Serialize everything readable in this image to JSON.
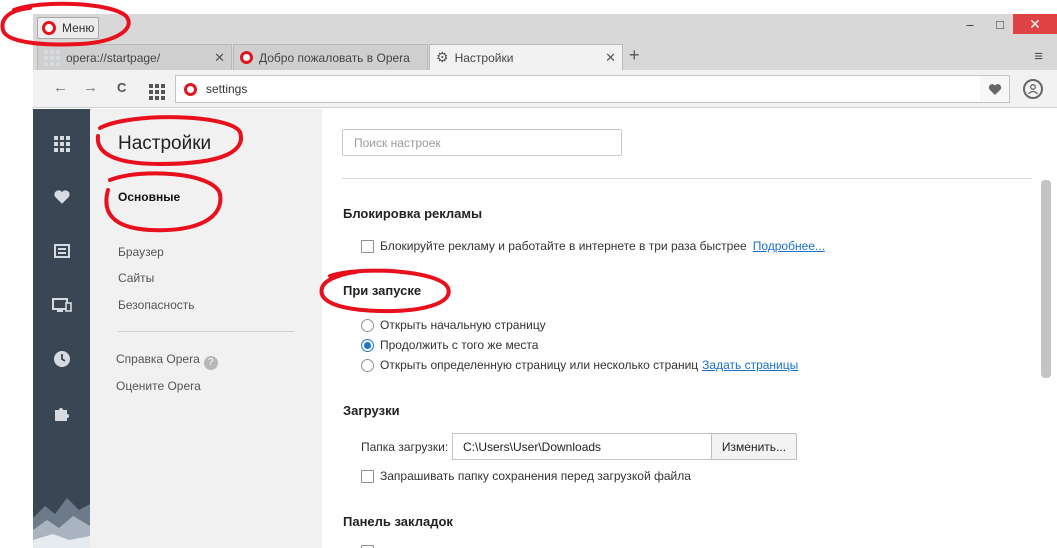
{
  "window": {
    "menu_label": "Меню",
    "controls": {
      "minimize": "–",
      "maximize": "□",
      "close": "✕"
    }
  },
  "tabs": [
    {
      "label": "opera://startpage/",
      "icon": "grid-icon",
      "active": false
    },
    {
      "label": "Добро пожаловать в Opera",
      "icon": "opera-icon",
      "active": false
    },
    {
      "label": "Настройки",
      "icon": "gear-icon",
      "active": true
    }
  ],
  "tabbar": {
    "new_tab": "+",
    "tab_menu": "≡",
    "close_glyph": "✕"
  },
  "address_bar": {
    "back": "←",
    "forward": "→",
    "reload": "C",
    "url": "settings"
  },
  "sidebar_icons": [
    "speed-dial-icon",
    "heart-icon",
    "news-icon",
    "devices-icon",
    "history-icon",
    "extensions-icon"
  ],
  "settings_nav": {
    "title": "Настройки",
    "items": [
      "Основные",
      "Браузер",
      "Сайты",
      "Безопасность"
    ],
    "help": "Справка Opera",
    "help_mark": "?",
    "rate": "Оцените Opera"
  },
  "main": {
    "search_placeholder": "Поиск настроек",
    "adblock": {
      "title": "Блокировка рекламы",
      "checkbox_label": "Блокируйте рекламу и работайте в интернете в три раза быстрее",
      "link": "Подробнее..."
    },
    "startup": {
      "title": "При запуске",
      "options": [
        "Открыть начальную страницу",
        "Продолжить с того же места",
        "Открыть определенную страницу или несколько страниц"
      ],
      "selected": 1,
      "link": "Задать страницы"
    },
    "downloads": {
      "title": "Загрузки",
      "folder_label": "Папка загрузки:",
      "folder_path": "C:\\Users\\User\\Downloads",
      "change_button": "Изменить...",
      "ask_checkbox": "Запрашивать папку сохранения перед загрузкой файла"
    },
    "bookmarks_bar": {
      "title": "Панель закладок"
    }
  },
  "colors": {
    "annotation_red": "#e8101c",
    "accent_blue": "#1e73c9",
    "opera_red": "#e0161e"
  }
}
